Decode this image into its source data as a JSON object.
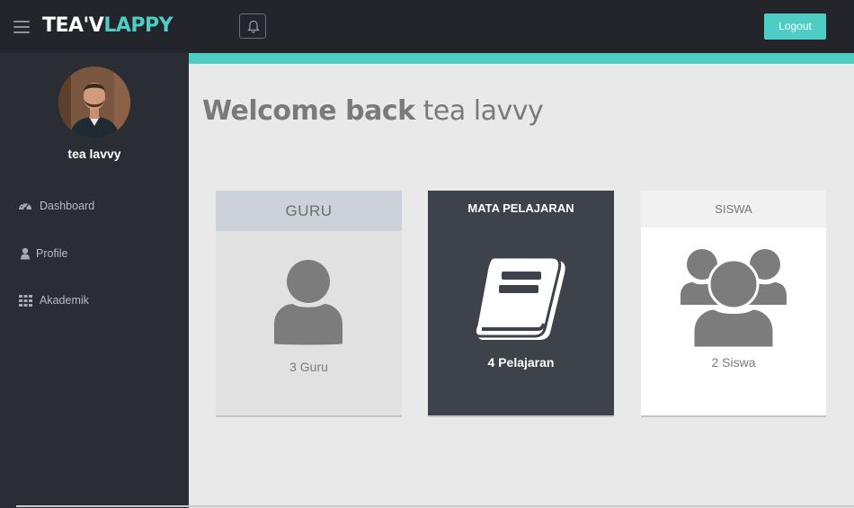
{
  "header": {
    "brand_part1": "TEA'V",
    "brand_part2": "LAPPY",
    "logout_label": "Logout",
    "menu_icon": "hamburger-icon",
    "notification_icon": "bell-icon"
  },
  "sidebar": {
    "username": "tea lavvy",
    "items": [
      {
        "label": "Dashboard",
        "icon": "dashboard-gauge-icon"
      },
      {
        "label": "Profile",
        "icon": "user-icon"
      },
      {
        "label": "Akademik",
        "icon": "grid-icon"
      }
    ]
  },
  "main": {
    "welcome_strong": "Welcome back",
    "welcome_user": "tea lavvy",
    "cards": [
      {
        "title": "GURU",
        "count": "3 Guru",
        "icon": "user-icon"
      },
      {
        "title": "MATA PELAJARAN",
        "count": "4 Pelajaran",
        "icon": "book-icon"
      },
      {
        "title": "SISWA",
        "count": "2 Siswa",
        "icon": "users-group-icon"
      }
    ]
  },
  "colors": {
    "accent": "#4ecdc4",
    "topbar": "#23252b",
    "sidebar": "#2a2d34",
    "card_dark": "#3e434b"
  }
}
